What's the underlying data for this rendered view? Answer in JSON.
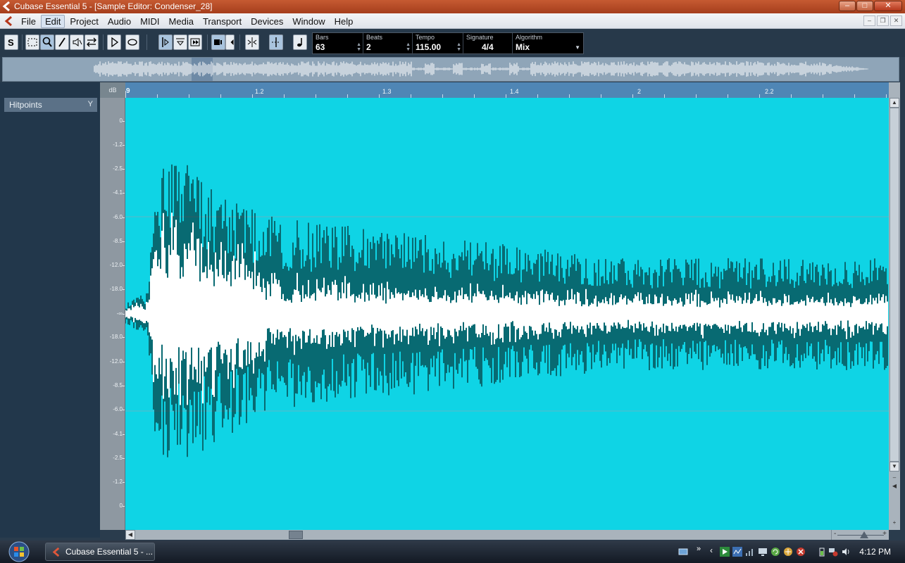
{
  "window": {
    "title": "Cubase Essential 5 - [Sample Editor: Condenser_28]",
    "buttons": [
      "minimize",
      "maximize",
      "close"
    ]
  },
  "menu": {
    "items": [
      "File",
      "Edit",
      "Project",
      "Audio",
      "MIDI",
      "Media",
      "Transport",
      "Devices",
      "Window",
      "Help"
    ],
    "active": "Edit"
  },
  "toolbar": {
    "solo_label": "S",
    "tools": [
      "range-selection-icon",
      "zoom-icon",
      "draw-icon",
      "mute-icon",
      "warp-icon",
      "play-icon",
      "loop-icon",
      "hitpoint-icon",
      "snap-icon",
      "musical-mode-icon"
    ],
    "selected_tool": "zoom-icon"
  },
  "info": {
    "bars": {
      "label": "Bars",
      "value": "63"
    },
    "beats": {
      "label": "Beats",
      "value": "2"
    },
    "tempo": {
      "label": "Tempo",
      "value": "115.00"
    },
    "signature": {
      "label": "Signature",
      "value": "4/4"
    },
    "algorithm": {
      "label": "Algorithm",
      "value": "Mix"
    }
  },
  "left_panel": {
    "section_label": "Hitpoints"
  },
  "db_scale": {
    "header": "dB",
    "ticks_top": [
      "0",
      "-1.2",
      "-2.5",
      "-4.1",
      "-6.0",
      "-8.5",
      "-12.0",
      "-18.0"
    ],
    "center": "-∞",
    "ticks_bottom": [
      "-18.0",
      "-12.0",
      "-8.5",
      "-6.0",
      "-4.1",
      "-2.5",
      "-1.2",
      "0"
    ]
  },
  "ruler": {
    "labels": [
      "9",
      "1.2",
      "1.3",
      "1.4",
      "2",
      "2.2"
    ]
  },
  "colors": {
    "waveform_bg": "#0fd4e5",
    "waveform_core": "#ffffff",
    "waveform_edge": "#000000",
    "title_bar": "#b44a26"
  },
  "taskbar": {
    "task_label": "Cubase Essential 5 - ...",
    "clock": "4:12 PM"
  }
}
